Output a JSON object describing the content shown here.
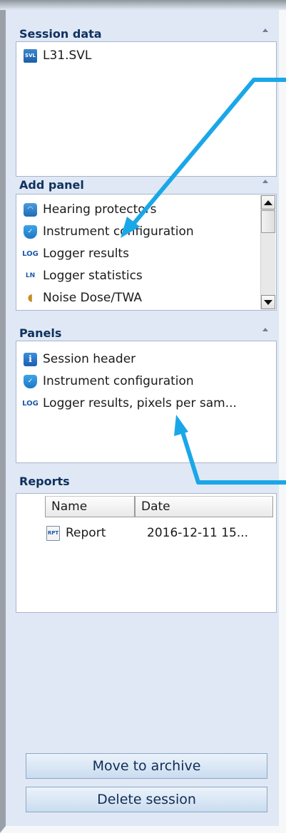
{
  "session_data": {
    "title": "Session data",
    "items": [
      {
        "label": "L31.SVL",
        "icon": "svl-file-icon"
      }
    ]
  },
  "add_panel": {
    "title": "Add panel",
    "items": [
      {
        "label": "Hearing protectors",
        "icon": "headphones-icon"
      },
      {
        "label": "Instrument configuration",
        "icon": "instrument-config-icon"
      },
      {
        "label": "Logger results",
        "icon": "logger-results-icon"
      },
      {
        "label": "Logger statistics",
        "icon": "logger-statistics-icon"
      },
      {
        "label": "Noise Dose/TWA",
        "icon": "ear-icon"
      }
    ]
  },
  "panels": {
    "title": "Panels",
    "items": [
      {
        "label": "Session header",
        "icon": "info-icon"
      },
      {
        "label": "Instrument configuration",
        "icon": "instrument-config-icon"
      },
      {
        "label": "Logger results, pixels per sam...",
        "icon": "logger-results-icon"
      }
    ]
  },
  "reports": {
    "title": "Reports",
    "columns": [
      "Name",
      "Date"
    ],
    "rows": [
      {
        "name": "Report",
        "date": "2016-12-11 15...",
        "icon": "report-icon"
      }
    ]
  },
  "buttons": {
    "archive": "Move to archive",
    "delete": "Delete session"
  },
  "colors": {
    "panel_bg": "#dfe8f4",
    "header_text": "#0f3160",
    "annotation_arrow": "#1aa7e8"
  }
}
